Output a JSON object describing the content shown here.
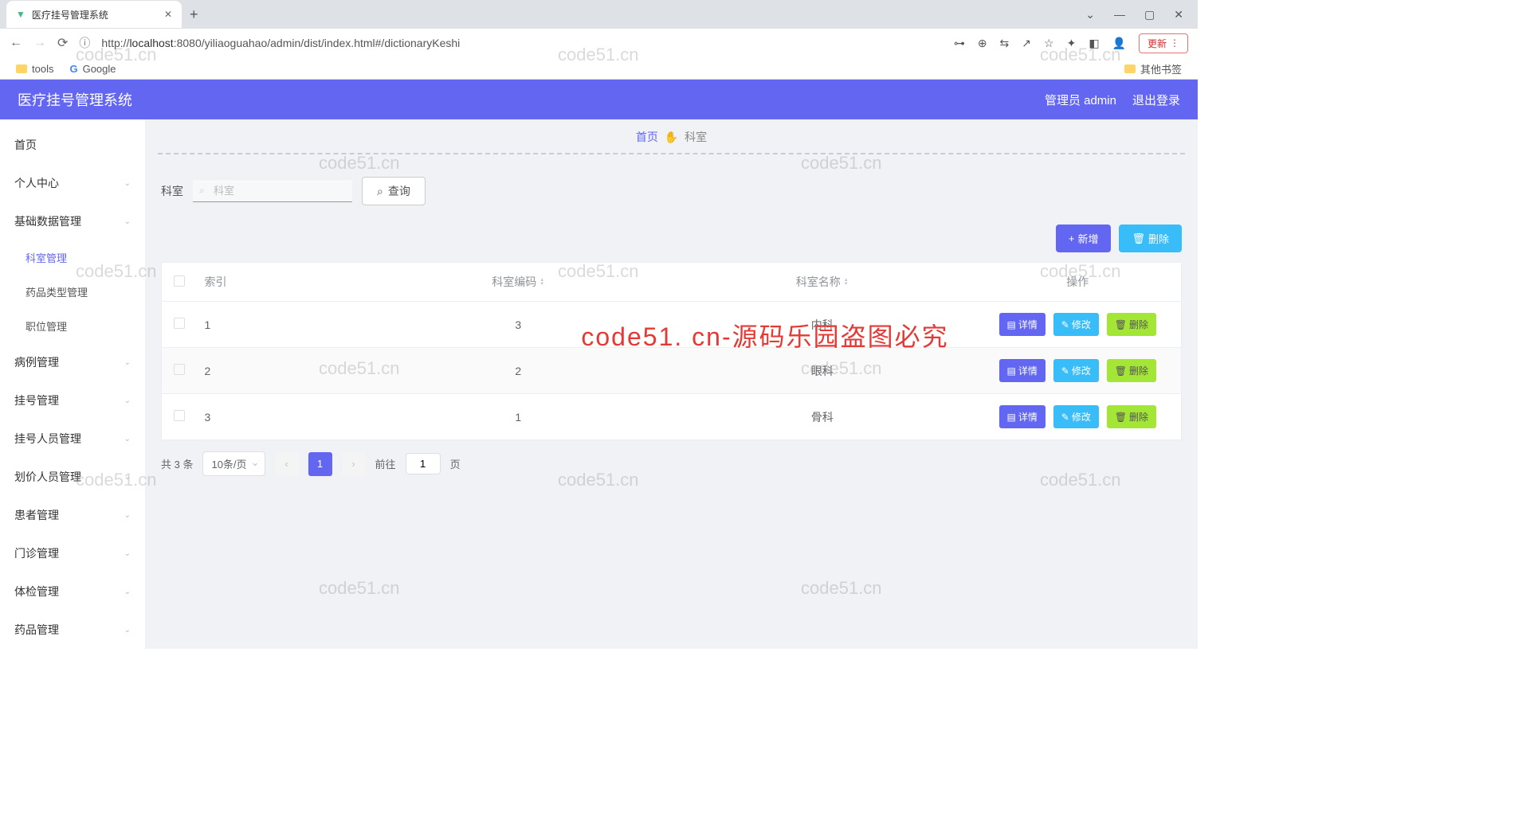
{
  "browser": {
    "tab_title": "医疗挂号管理系统",
    "url_host": "localhost",
    "url_path": ":8080/yiliaoguahao/admin/dist/index.html#/dictionaryKeshi",
    "update_btn": "更新",
    "bookmarks": {
      "tools": "tools",
      "google": "Google",
      "other": "其他书签"
    }
  },
  "header": {
    "title": "医疗挂号管理系统",
    "user": "管理员 admin",
    "logout": "退出登录"
  },
  "sidebar": {
    "items": [
      {
        "label": "首页",
        "sub": false
      },
      {
        "label": "个人中心",
        "sub": true
      },
      {
        "label": "基础数据管理",
        "sub": true,
        "open": true,
        "children": [
          {
            "label": "科室管理",
            "active": true
          },
          {
            "label": "药品类型管理"
          },
          {
            "label": "职位管理"
          }
        ]
      },
      {
        "label": "病例管理",
        "sub": true
      },
      {
        "label": "挂号管理",
        "sub": true
      },
      {
        "label": "挂号人员管理",
        "sub": true
      },
      {
        "label": "划价人员管理",
        "sub": true
      },
      {
        "label": "患者管理",
        "sub": true
      },
      {
        "label": "门诊管理",
        "sub": true
      },
      {
        "label": "体检管理",
        "sub": true
      },
      {
        "label": "药品管理",
        "sub": true
      }
    ]
  },
  "breadcrumb": {
    "home": "首页",
    "current": "科室"
  },
  "search": {
    "label": "科室",
    "placeholder": "科室",
    "query_btn": "查询"
  },
  "toolbar": {
    "add": "新增",
    "delete": "删除"
  },
  "table": {
    "headers": {
      "index": "索引",
      "code": "科室编码",
      "name": "科室名称",
      "ops": "操作"
    },
    "rows": [
      {
        "index": "1",
        "code": "3",
        "name": "内科"
      },
      {
        "index": "2",
        "code": "2",
        "name": "眼科"
      },
      {
        "index": "3",
        "code": "1",
        "name": "骨科"
      }
    ],
    "row_buttons": {
      "detail": "详情",
      "edit": "修改",
      "delete": "删除"
    }
  },
  "pagination": {
    "total": "共 3 条",
    "per_page": "10条/页",
    "current": "1",
    "goto_prefix": "前往",
    "goto_value": "1",
    "goto_suffix": "页"
  },
  "watermark_text": "code51.cn",
  "big_red": "code51. cn-源码乐园盗图必究"
}
